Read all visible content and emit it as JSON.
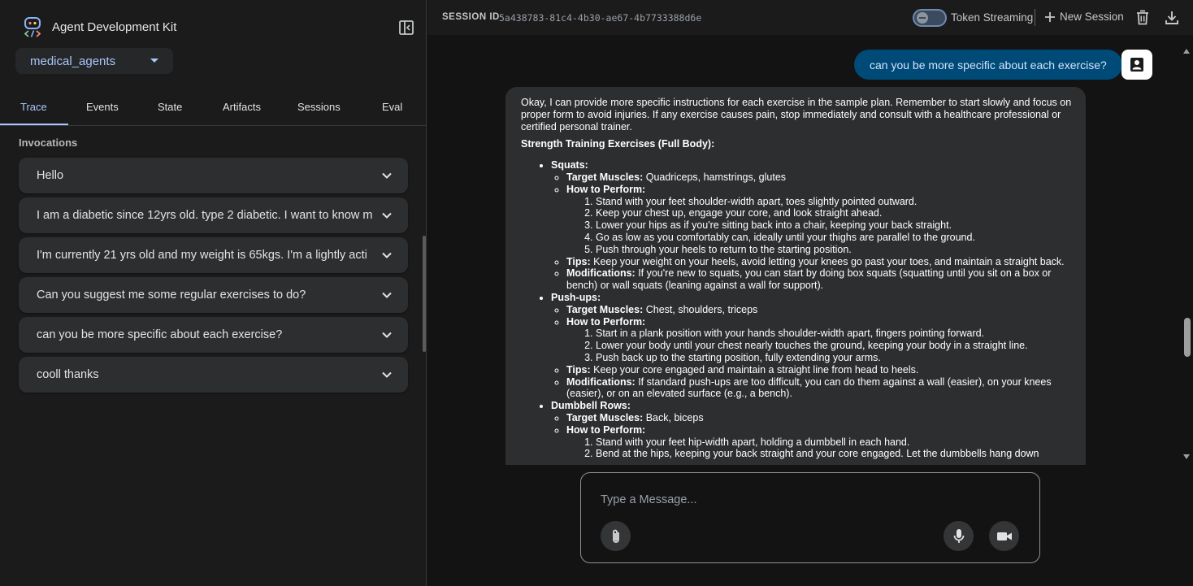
{
  "sidebar": {
    "brand": "Agent Development Kit",
    "app_selected": "medical_agents",
    "tabs": [
      {
        "label": "Trace",
        "active": true
      },
      {
        "label": "Events"
      },
      {
        "label": "State"
      },
      {
        "label": "Artifacts"
      },
      {
        "label": "Sessions"
      },
      {
        "label": "Eval"
      }
    ],
    "invocations_title": "Invocations",
    "invocations": [
      "Hello",
      "I am a diabetic since 12yrs old. type 2 diabetic. I want to know m",
      "I'm currently 21 yrs old and my weight is 65kgs. I'm a lightly acti",
      "Can you suggest me some regular exercises to do?",
      "can you be more specific about each exercise?",
      "cooll thanks"
    ]
  },
  "topbar": {
    "session_label": "SESSION ID",
    "session_id": "5a438783-81c4-4b30-ae67-4b7733388d6e",
    "token_streaming_label": "Token Streaming",
    "token_streaming_on": false,
    "new_session_label": "New Session"
  },
  "chat": {
    "user_message": "can you be more specific about each exercise?",
    "bot": {
      "intro": "Okay, I can provide more specific instructions for each exercise in the sample plan. Remember to start slowly and focus on proper form to avoid injuries. If any exercise causes pain, stop immediately and consult with a healthcare professional or certified personal trainer.",
      "heading": "Strength Training Exercises (Full Body):",
      "exercises": [
        {
          "name": "Squats:",
          "target_label": "Target Muscles:",
          "target": " Quadriceps, hamstrings, glutes",
          "how_label": "How to Perform:",
          "steps": [
            "Stand with your feet shoulder-width apart, toes slightly pointed outward.",
            "Keep your chest up, engage your core, and look straight ahead.",
            "Lower your hips as if you're sitting back into a chair, keeping your back straight.",
            "Go as low as you comfortably can, ideally until your thighs are parallel to the ground.",
            "Push through your heels to return to the starting position."
          ],
          "tips_label": "Tips:",
          "tips": " Keep your weight on your heels, avoid letting your knees go past your toes, and maintain a straight back.",
          "mods_label": "Modifications:",
          "mods": " If you're new to squats, you can start by doing box squats (squatting until you sit on a box or bench) or wall squats (leaning against a wall for support)."
        },
        {
          "name": "Push-ups:",
          "target_label": "Target Muscles:",
          "target": " Chest, shoulders, triceps",
          "how_label": "How to Perform:",
          "steps": [
            "Start in a plank position with your hands shoulder-width apart, fingers pointing forward.",
            "Lower your body until your chest nearly touches the ground, keeping your body in a straight line.",
            "Push back up to the starting position, fully extending your arms."
          ],
          "tips_label": "Tips:",
          "tips": " Keep your core engaged and maintain a straight line from head to heels.",
          "mods_label": "Modifications:",
          "mods": " If standard push-ups are too difficult, you can do them against a wall (easier), on your knees (easier), or on an elevated surface (e.g., a bench)."
        },
        {
          "name": "Dumbbell Rows:",
          "target_label": "Target Muscles:",
          "target": " Back, biceps",
          "how_label": "How to Perform:",
          "steps": [
            "Stand with your feet hip-width apart, holding a dumbbell in each hand.",
            "Bend at the hips, keeping your back straight and your core engaged. Let the dumbbells hang down"
          ]
        }
      ]
    }
  },
  "composer": {
    "placeholder": "Type a Message..."
  },
  "colors": {
    "accent": "#a8c7fa",
    "user_bubble": "#004a77",
    "bot_bubble": "#2d2e30",
    "sidebar_bg": "#1b1b1c"
  }
}
